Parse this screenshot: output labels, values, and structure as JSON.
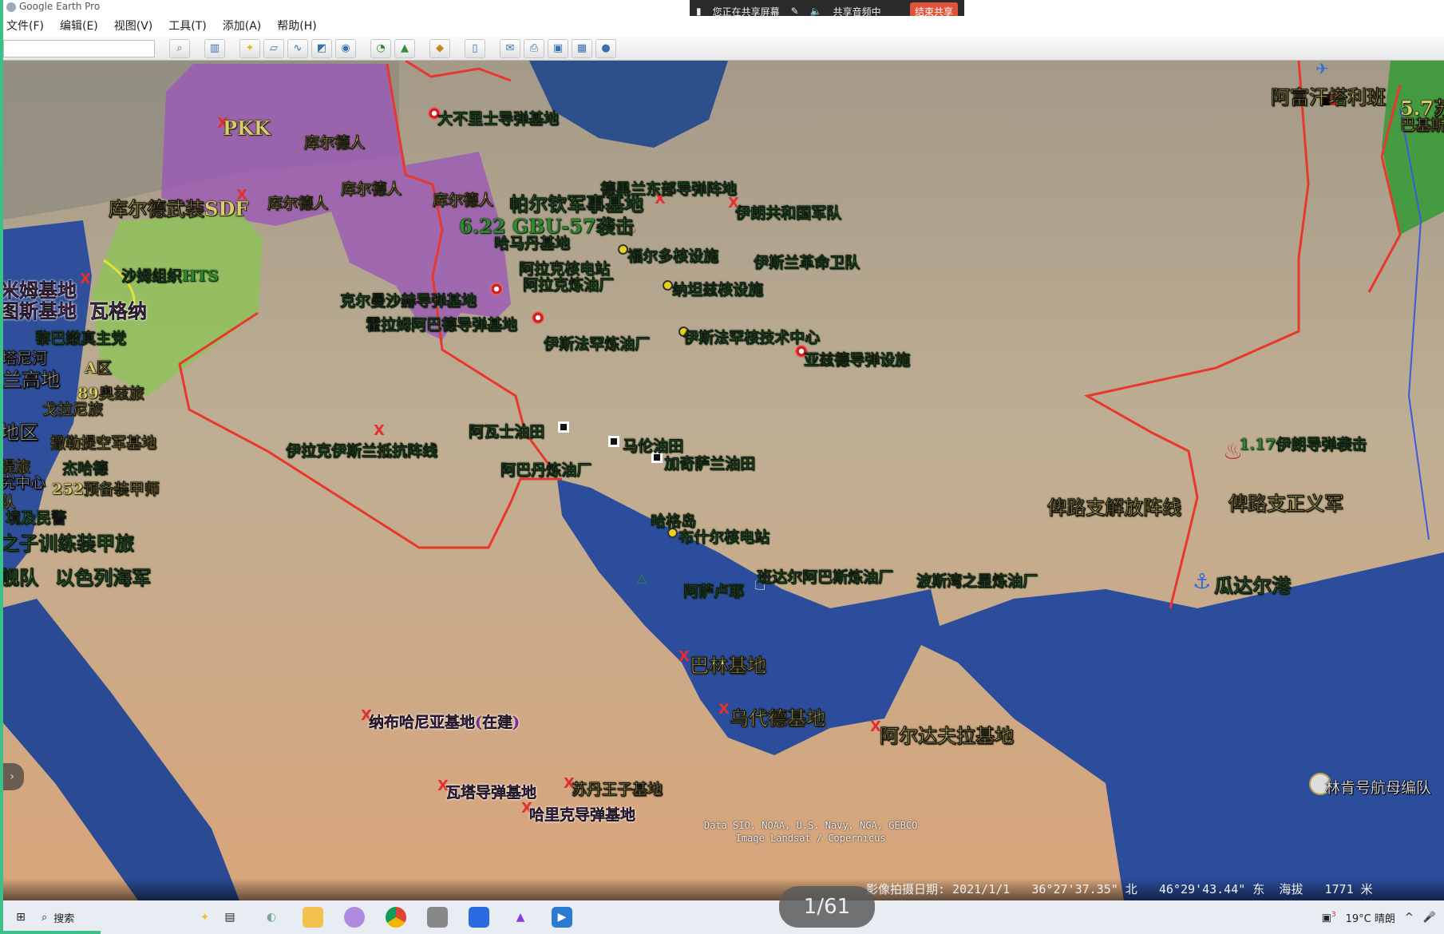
{
  "window": {
    "title": "Google Earth Pro"
  },
  "share_bar": {
    "status": "您正在共享屏幕",
    "audio": "共享音频中",
    "end_button": "结束共享"
  },
  "menu": [
    "文件(F)",
    "编辑(E)",
    "视图(V)",
    "工具(T)",
    "添加(A)",
    "帮助(H)"
  ],
  "toolbar": {
    "search_placeholder": "",
    "icons": [
      "search-icon",
      "sidebar-icon",
      "placemark-icon",
      "polygon-icon",
      "path-icon",
      "image-overlay-icon",
      "record-tour-icon",
      "historical-imagery-icon",
      "sunlight-icon",
      "planets-icon",
      "ruler-icon",
      "email-icon",
      "print-icon",
      "save-image-icon",
      "map-view-icon",
      "earth-icon"
    ]
  },
  "labels": [
    "PKK",
    "库尔德人",
    "库尔德人",
    "库尔德人",
    "库尔德人",
    "库尔德武装SDF",
    "沙姆组织HTS",
    "米姆基地",
    "图斯基地",
    "瓦格纳",
    "黎巴嫩真主党",
    "塔尼河",
    "A区",
    "兰高地",
    "89奥兹旅",
    "戈拉尼旅",
    "地区",
    "撒勒提空军基地",
    "杰哈德",
    "252预备装甲师",
    "提旅",
    "究中心",
    "队",
    "境及民警",
    "之子训练装甲旅",
    "舰队",
    "以色列海军",
    "伊拉克伊斯兰抵抗阵线",
    "大不里士导弹基地",
    "帕尔钦军事基地",
    "6.22 GBU-57袭击",
    "哈马丹基地",
    "德黑兰东部导弹阵地",
    "伊朗共和国军队",
    "福尔多核设施",
    "伊斯兰革命卫队",
    "阿拉克核电站",
    "阿拉克炼油厂",
    "纳坦兹核设施",
    "克尔曼沙赫导弹基地",
    "霍拉姆阿巴德导弹基地",
    "伊斯法罕炼油厂",
    "伊斯法罕核技术中心",
    "亚兹德导弹设施",
    "阿瓦士油田",
    "马伦油田",
    "加奇萨兰油田",
    "阿巴丹炼油厂",
    "哈格岛",
    "布什尔核电站",
    "班达尔阿巴斯炼油厂",
    "阿萨卢耶",
    "波斯湾之星炼油厂",
    "阿富汗塔利班",
    "5.7苏",
    "巴基斯",
    "1.17伊朗导弹袭击",
    "俾路支解放阵线",
    "俾路支正义军",
    "瓜达尔港",
    "巴林基地",
    "乌代德基地",
    "阿尔达夫拉基地",
    "纳布哈尼亚基地(在建)",
    "瓦塔导弹基地",
    "苏丹王子基地",
    "哈里克导弹基地",
    "林肯号航母编队"
  ],
  "attribution": {
    "line1": "Data SIO, NOAA, U.S. Navy, NGA, GEBCO",
    "line2": "Image Landsat / Copernicus"
  },
  "status_bar": {
    "imagery_date": "影像拍摄日期: 2021/1/1",
    "latitude": "36°27'37.35\" 北",
    "longitude": "46°29'43.44\" 东",
    "elevation_label": "海拔",
    "elevation": "1771 米"
  },
  "taskbar": {
    "search": "搜索",
    "weather": "19°C 晴朗",
    "badge": "3"
  },
  "slide_counter": "1/61",
  "colors": {
    "border": "#e8382e",
    "kurd": "#9b59b6",
    "syria": "#8fc25a",
    "pakistan": "#3a9a3a",
    "sea": "#2f4f9a"
  }
}
